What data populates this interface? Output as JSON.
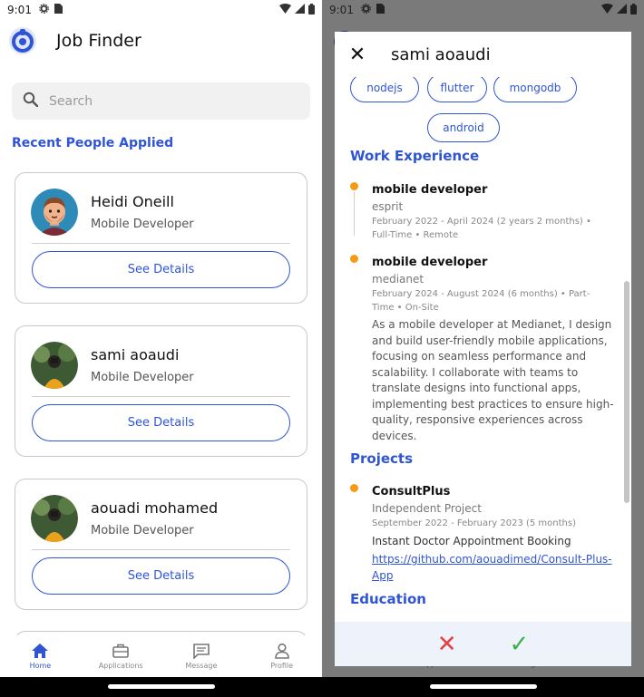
{
  "status_bar": {
    "time": "9:01"
  },
  "app": {
    "title": "Job Finder"
  },
  "search": {
    "placeholder": "Search"
  },
  "recent": {
    "title": "Recent People Applied",
    "button_label": "See Details",
    "people": [
      {
        "name": "Heidi Oneill",
        "role": "Mobile Developer"
      },
      {
        "name": "sami aoaudi",
        "role": "Mobile Developer"
      },
      {
        "name": "aouadi mohamed",
        "role": "Mobile Developer"
      }
    ]
  },
  "nav": {
    "items": [
      {
        "label": "Home",
        "icon": "home-icon",
        "active": true
      },
      {
        "label": "Applications",
        "icon": "briefcase-icon",
        "active": false
      },
      {
        "label": "Message",
        "icon": "message-icon",
        "active": false
      },
      {
        "label": "Profile",
        "icon": "profile-icon",
        "active": false
      }
    ]
  },
  "detail": {
    "title": "sami aoaudi",
    "skills": [
      "nodejs",
      "flutter",
      "mongodb",
      "android"
    ],
    "work_heading": "Work Experience",
    "work": [
      {
        "title": "mobile developer",
        "company": "esprit",
        "meta": "February 2022 - April 2024 (2 years 2 months) • Full-Time • Remote"
      },
      {
        "title": "mobile developer",
        "company": "medianet",
        "meta": "February 2024 - August 2024 (6 months) • Part-Time • On-Site",
        "description": "As a mobile developer at Medianet, I design and build user-friendly mobile applications, focusing on seamless performance and scalability. I collaborate with teams to translate designs into functional apps, implementing best practices to ensure high-quality, responsive experiences across devices."
      }
    ],
    "projects_heading": "Projects",
    "projects": [
      {
        "title": "ConsultPlus",
        "type": "Independent Project",
        "meta": "September 2022 - February 2023 (5 months)",
        "description": "Instant Doctor Appointment Booking",
        "link": "https://github.com/aouadimed/Consult-Plus-App"
      }
    ],
    "education_heading": "Education"
  },
  "colors": {
    "accent": "#2f55d4",
    "timeline_dot": "#f59a12",
    "reject": "#e34040",
    "accept": "#3cae4a"
  }
}
